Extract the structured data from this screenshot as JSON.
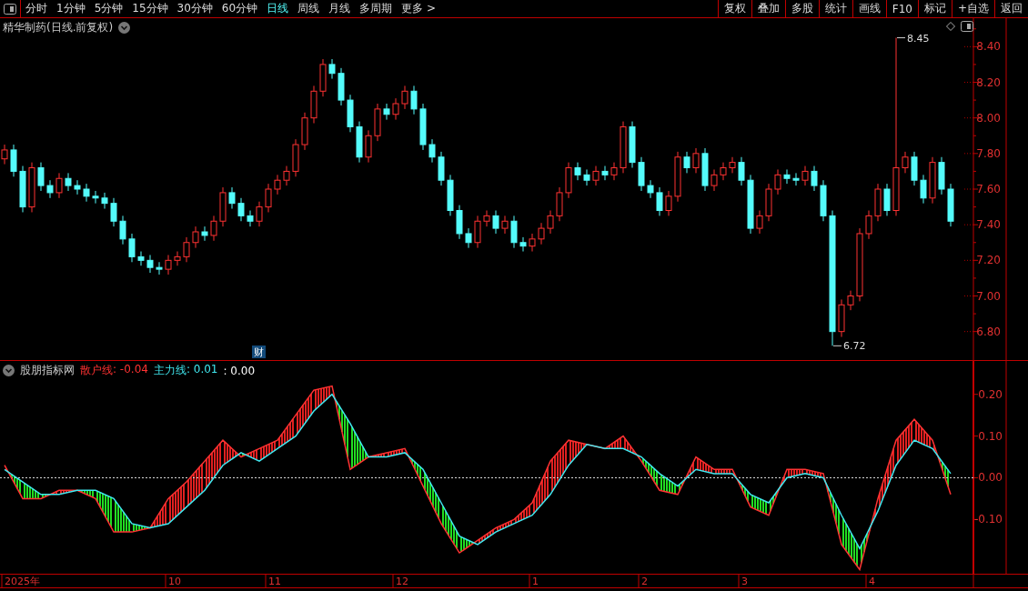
{
  "toolbar": {
    "tabs": [
      {
        "label": "分时",
        "selected": false
      },
      {
        "label": "1分钟",
        "selected": false
      },
      {
        "label": "5分钟",
        "selected": false
      },
      {
        "label": "15分钟",
        "selected": false
      },
      {
        "label": "30分钟",
        "selected": false
      },
      {
        "label": "60分钟",
        "selected": false
      },
      {
        "label": "日线",
        "selected": true
      },
      {
        "label": "周线",
        "selected": false
      },
      {
        "label": "月线",
        "selected": false
      },
      {
        "label": "多周期",
        "selected": false
      },
      {
        "label": "更多 >",
        "selected": false
      }
    ],
    "buttons": [
      "复权",
      "叠加",
      "多股",
      "统计",
      "画线",
      "F10",
      "标记",
      "+自选",
      "返回"
    ]
  },
  "price_panel": {
    "title": "精华制药(日线.前复权)",
    "badge": "财",
    "high_label": "8.45",
    "low_label": "6.72",
    "chart_data": {
      "type": "candlestick",
      "ylim": [
        6.64,
        8.56
      ],
      "yticks": [
        {
          "value": 8.4,
          "label": "8.40"
        },
        {
          "value": 8.2,
          "label": "8.20"
        },
        {
          "value": 8.0,
          "label": "8.00"
        },
        {
          "value": 7.8,
          "label": "7.80"
        },
        {
          "value": 7.6,
          "label": "7.60"
        },
        {
          "value": 7.4,
          "label": "7.40"
        },
        {
          "value": 7.2,
          "label": "7.20"
        },
        {
          "value": 7.0,
          "label": "7.00"
        },
        {
          "value": 6.8,
          "label": "6.80"
        }
      ],
      "categories": [
        null,
        null,
        null,
        null,
        null,
        null,
        null,
        null,
        null,
        null,
        null,
        null,
        null,
        null,
        null,
        null,
        null,
        null,
        null,
        null,
        null,
        null,
        null,
        null,
        null,
        null,
        null,
        null,
        null,
        null,
        null,
        null,
        null,
        null,
        null,
        null,
        null,
        null,
        null,
        null,
        null,
        null,
        null,
        null,
        null,
        null,
        null,
        null,
        null,
        null,
        null,
        null,
        null,
        null,
        null,
        null,
        null,
        null,
        null,
        null,
        null,
        null,
        null,
        null,
        null,
        null,
        null,
        null,
        null,
        null,
        null,
        null,
        null,
        null,
        null,
        null,
        null,
        null,
        null,
        null,
        null,
        null,
        null,
        null,
        null,
        null,
        null,
        null,
        null,
        null,
        null,
        null,
        null,
        null,
        null,
        null,
        null,
        null,
        null,
        null,
        null,
        null,
        null,
        null,
        null
      ],
      "ohlc": [
        [
          7.77,
          7.85,
          7.74,
          7.82
        ],
        [
          7.82,
          7.85,
          7.67,
          7.7
        ],
        [
          7.7,
          7.73,
          7.47,
          7.5
        ],
        [
          7.5,
          7.75,
          7.47,
          7.72
        ],
        [
          7.72,
          7.75,
          7.59,
          7.62
        ],
        [
          7.62,
          7.65,
          7.55,
          7.58
        ],
        [
          7.58,
          7.69,
          7.55,
          7.66
        ],
        [
          7.66,
          7.69,
          7.59,
          7.62
        ],
        [
          7.62,
          7.65,
          7.57,
          7.6
        ],
        [
          7.6,
          7.63,
          7.53,
          7.56
        ],
        [
          7.56,
          7.59,
          7.52,
          7.55
        ],
        [
          7.55,
          7.58,
          7.49,
          7.52
        ],
        [
          7.52,
          7.55,
          7.39,
          7.42
        ],
        [
          7.42,
          7.45,
          7.29,
          7.32
        ],
        [
          7.32,
          7.35,
          7.19,
          7.22
        ],
        [
          7.22,
          7.25,
          7.17,
          7.2
        ],
        [
          7.2,
          7.23,
          7.13,
          7.16
        ],
        [
          7.16,
          7.19,
          7.12,
          7.15
        ],
        [
          7.15,
          7.23,
          7.12,
          7.2
        ],
        [
          7.2,
          7.25,
          7.17,
          7.22
        ],
        [
          7.22,
          7.33,
          7.19,
          7.3
        ],
        [
          7.3,
          7.39,
          7.27,
          7.36
        ],
        [
          7.36,
          7.39,
          7.31,
          7.34
        ],
        [
          7.34,
          7.45,
          7.31,
          7.42
        ],
        [
          7.42,
          7.61,
          7.39,
          7.58
        ],
        [
          7.58,
          7.61,
          7.49,
          7.52
        ],
        [
          7.52,
          7.55,
          7.42,
          7.45
        ],
        [
          7.45,
          7.48,
          7.39,
          7.42
        ],
        [
          7.42,
          7.53,
          7.39,
          7.5
        ],
        [
          7.5,
          7.63,
          7.47,
          7.6
        ],
        [
          7.6,
          7.68,
          7.57,
          7.65
        ],
        [
          7.65,
          7.73,
          7.62,
          7.7
        ],
        [
          7.7,
          7.88,
          7.67,
          7.85
        ],
        [
          7.85,
          8.03,
          7.82,
          8.0
        ],
        [
          8.0,
          8.18,
          7.97,
          8.15
        ],
        [
          8.15,
          8.33,
          8.12,
          8.3
        ],
        [
          8.3,
          8.33,
          8.22,
          8.25
        ],
        [
          8.25,
          8.28,
          8.07,
          8.1
        ],
        [
          8.1,
          8.13,
          7.92,
          7.95
        ],
        [
          7.95,
          7.98,
          7.75,
          7.78
        ],
        [
          7.78,
          7.93,
          7.75,
          7.9
        ],
        [
          7.9,
          8.08,
          7.87,
          8.05
        ],
        [
          8.05,
          8.08,
          7.99,
          8.02
        ],
        [
          8.02,
          8.11,
          7.99,
          8.08
        ],
        [
          8.08,
          8.18,
          8.05,
          8.15
        ],
        [
          8.15,
          8.18,
          8.02,
          8.05
        ],
        [
          8.05,
          8.08,
          7.82,
          7.85
        ],
        [
          7.85,
          7.88,
          7.75,
          7.78
        ],
        [
          7.78,
          7.81,
          7.62,
          7.65
        ],
        [
          7.65,
          7.68,
          7.45,
          7.48
        ],
        [
          7.48,
          7.51,
          7.32,
          7.35
        ],
        [
          7.35,
          7.38,
          7.27,
          7.3
        ],
        [
          7.3,
          7.45,
          7.27,
          7.42
        ],
        [
          7.42,
          7.48,
          7.39,
          7.45
        ],
        [
          7.45,
          7.48,
          7.35,
          7.38
        ],
        [
          7.38,
          7.45,
          7.35,
          7.42
        ],
        [
          7.42,
          7.45,
          7.27,
          7.3
        ],
        [
          7.3,
          7.33,
          7.25,
          7.28
        ],
        [
          7.28,
          7.35,
          7.25,
          7.32
        ],
        [
          7.32,
          7.41,
          7.29,
          7.38
        ],
        [
          7.38,
          7.48,
          7.35,
          7.45
        ],
        [
          7.45,
          7.61,
          7.42,
          7.58
        ],
        [
          7.58,
          7.75,
          7.55,
          7.72
        ],
        [
          7.72,
          7.75,
          7.65,
          7.68
        ],
        [
          7.68,
          7.71,
          7.62,
          7.65
        ],
        [
          7.65,
          7.73,
          7.62,
          7.7
        ],
        [
          7.7,
          7.73,
          7.65,
          7.68
        ],
        [
          7.68,
          7.75,
          7.65,
          7.72
        ],
        [
          7.72,
          7.98,
          7.69,
          7.95
        ],
        [
          7.95,
          7.98,
          7.72,
          7.75
        ],
        [
          7.75,
          7.78,
          7.59,
          7.62
        ],
        [
          7.62,
          7.65,
          7.55,
          7.58
        ],
        [
          7.58,
          7.61,
          7.45,
          7.48
        ],
        [
          7.48,
          7.59,
          7.45,
          7.56
        ],
        [
          7.56,
          7.81,
          7.53,
          7.78
        ],
        [
          7.78,
          7.81,
          7.69,
          7.72
        ],
        [
          7.72,
          7.83,
          7.69,
          7.8
        ],
        [
          7.8,
          7.83,
          7.59,
          7.62
        ],
        [
          7.62,
          7.71,
          7.59,
          7.68
        ],
        [
          7.68,
          7.75,
          7.65,
          7.72
        ],
        [
          7.72,
          7.78,
          7.69,
          7.75
        ],
        [
          7.75,
          7.78,
          7.62,
          7.65
        ],
        [
          7.65,
          7.68,
          7.35,
          7.38
        ],
        [
          7.38,
          7.48,
          7.35,
          7.45
        ],
        [
          7.45,
          7.63,
          7.42,
          7.6
        ],
        [
          7.6,
          7.71,
          7.57,
          7.68
        ],
        [
          7.68,
          7.71,
          7.63,
          7.66
        ],
        [
          7.66,
          7.69,
          7.62,
          7.65
        ],
        [
          7.65,
          7.73,
          7.62,
          7.7
        ],
        [
          7.7,
          7.73,
          7.59,
          7.62
        ],
        [
          7.62,
          7.65,
          7.42,
          7.45
        ],
        [
          7.45,
          7.48,
          6.72,
          6.8
        ],
        [
          6.8,
          6.98,
          6.77,
          6.95
        ],
        [
          6.95,
          7.03,
          6.92,
          7.0
        ],
        [
          7.0,
          7.38,
          6.97,
          7.35
        ],
        [
          7.35,
          7.48,
          7.32,
          7.45
        ],
        [
          7.45,
          7.63,
          7.42,
          7.6
        ],
        [
          7.6,
          7.63,
          7.45,
          7.48
        ],
        [
          7.48,
          8.45,
          7.45,
          7.72
        ],
        [
          7.72,
          7.81,
          7.69,
          7.78
        ],
        [
          7.78,
          7.81,
          7.62,
          7.65
        ],
        [
          7.65,
          7.68,
          7.52,
          7.55
        ],
        [
          7.55,
          7.78,
          7.52,
          7.75
        ],
        [
          7.75,
          7.78,
          7.57,
          7.6
        ],
        [
          7.6,
          7.63,
          7.39,
          7.42
        ]
      ]
    }
  },
  "indicator_panel": {
    "title": "股朋指标网",
    "legend": [
      {
        "text": ": -0.04",
        "color": "#ff3232"
      },
      {
        "text": ": 0.01",
        "color": "#40e8f0"
      },
      {
        "text": ": 0.00",
        "color": "#ffffff"
      }
    ],
    "chart_data": {
      "type": "line",
      "yticks": [
        {
          "value": -0.1,
          "label": "-0.10"
        },
        {
          "value": 0,
          "label": "0.00"
        },
        {
          "value": 0.1,
          "label": "0.10"
        },
        {
          "value": 0.2,
          "label": "0.20"
        }
      ],
      "ylim": [
        -0.23,
        0.28
      ],
      "series": [
        {
          "name": "散户线",
          "color": "#ff3232",
          "values": [
            0.03,
            -0.05,
            -0.05,
            -0.03,
            -0.03,
            -0.05,
            -0.13,
            -0.13,
            -0.12,
            -0.05,
            -0.01,
            0.04,
            0.09,
            0.05,
            0.07,
            0.09,
            0.15,
            0.21,
            0.22,
            0.02,
            0.05,
            0.06,
            0.07,
            -0.02,
            -0.11,
            -0.18,
            -0.15,
            -0.12,
            -0.1,
            -0.06,
            0.04,
            0.09,
            0.08,
            0.07,
            0.1,
            0.04,
            -0.03,
            -0.04,
            0.05,
            0.02,
            0.02,
            -0.07,
            -0.09,
            0.02,
            0.02,
            0.01,
            -0.16,
            -0.22,
            -0.05,
            0.09,
            0.14,
            0.09,
            -0.04
          ]
        },
        {
          "name": "主力线",
          "color": "#40e8f0",
          "values": [
            0.02,
            -0.01,
            -0.04,
            -0.04,
            -0.03,
            -0.03,
            -0.05,
            -0.11,
            -0.12,
            -0.11,
            -0.07,
            -0.03,
            0.03,
            0.06,
            0.04,
            0.07,
            0.1,
            0.16,
            0.2,
            0.13,
            0.05,
            0.05,
            0.06,
            0.02,
            -0.06,
            -0.14,
            -0.16,
            -0.13,
            -0.11,
            -0.09,
            -0.04,
            0.03,
            0.08,
            0.07,
            0.07,
            0.05,
            0.01,
            -0.02,
            0.02,
            0.01,
            0.01,
            -0.04,
            -0.06,
            0.0,
            0.01,
            0.0,
            -0.09,
            -0.17,
            -0.08,
            0.03,
            0.09,
            0.07,
            0.01
          ]
        }
      ]
    }
  },
  "date_axis": [
    "2025年",
    "10",
    "11",
    "12",
    "1",
    "2",
    "3",
    "4"
  ]
}
